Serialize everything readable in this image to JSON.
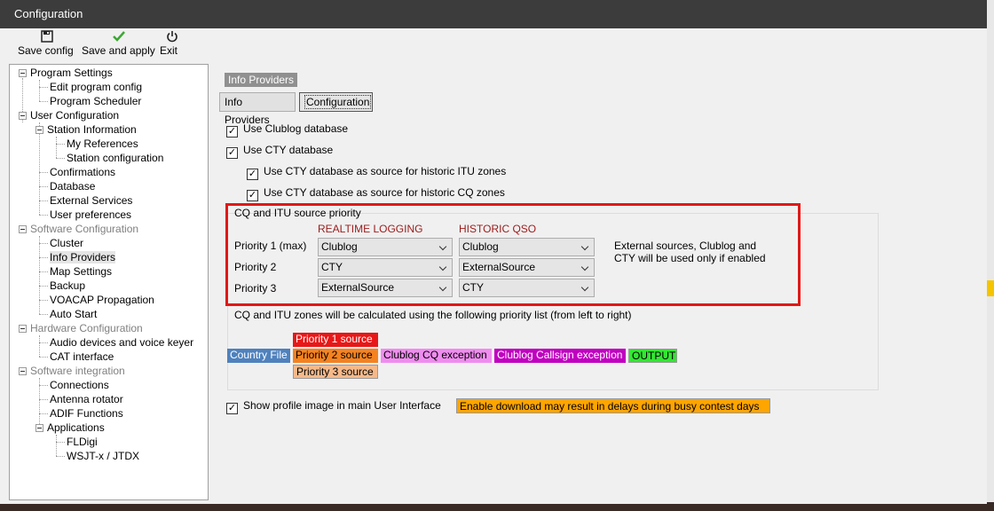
{
  "window": {
    "title": "Configuration"
  },
  "toolbar": {
    "save_config": "Save config",
    "save_apply": "Save and apply",
    "exit": "Exit"
  },
  "tree": {
    "program_settings": "Program Settings",
    "edit_program_config": "Edit program config",
    "program_scheduler": "Program Scheduler",
    "user_configuration": "User Configuration",
    "station_information": "Station Information",
    "my_references": "My References",
    "station_configuration": "Station configuration",
    "confirmations": "Confirmations",
    "database": "Database",
    "external_services": "External Services",
    "user_preferences": "User preferences",
    "software_configuration": "Software Configuration",
    "cluster": "Cluster",
    "info_providers": "Info Providers",
    "map_settings": "Map Settings",
    "backup": "Backup",
    "voacap": "VOACAP Propagation",
    "auto_start": "Auto Start",
    "hardware_configuration": "Hardware Configuration",
    "audio_devices": "Audio devices and voice keyer",
    "cat_interface": "CAT interface",
    "software_integration": "Software integration",
    "connections": "Connections",
    "antenna_rotator": "Antenna rotator",
    "adif_functions": "ADIF Functions",
    "applications": "Applications",
    "fldigi": "FLDigi",
    "wsjt": "WSJT-x / JTDX"
  },
  "page": {
    "group_title": "Info Providers",
    "tabs": [
      "Info Providers",
      "Configuration"
    ],
    "active_tab": "Configuration"
  },
  "options": {
    "use_clublog": "Use Clublog database",
    "use_cty": "Use CTY database",
    "cty_itu": "Use CTY database as source for historic ITU zones",
    "cty_cq": "Use CTY database as source for historic CQ zones",
    "show_profile": "Show profile image in main User Interface",
    "profile_warning": "Enable download may result in delays during busy contest days",
    "checked": "✓"
  },
  "priority": {
    "title": "CQ and ITU source priority",
    "realtime_header": "REALTIME LOGGING",
    "historic_header": "HISTORIC QSO",
    "row_labels": [
      "Priority 1 (max)",
      "Priority 2",
      "Priority 3"
    ],
    "realtime": [
      "Clublog",
      "CTY",
      "ExternalSource"
    ],
    "historic": [
      "Clublog",
      "ExternalSource",
      "CTY"
    ],
    "note_line1": "External sources, Clublog and",
    "note_line2": "CTY will be used only if enabled",
    "explanation": "CQ and ITU zones will be calculated using the following priority list (from left to right)"
  },
  "flow": {
    "country_file": "Country File",
    "priority1": "Priority 1 source",
    "priority2": "Priority 2 source",
    "priority3": "Priority 3 source",
    "clublog_cq": "Clublog CQ exception",
    "clublog_call": "Clublog Callsign exception",
    "output": "OUTPUT"
  },
  "colors": {
    "country_file": "#4f81bd",
    "priority1": "#e81818",
    "priority2": "#f58220",
    "priority3": "#f5b98a",
    "clublog_cq": "#f08cf0",
    "clublog_call": "#c000c0",
    "output": "#33e633",
    "warning": "#ffa500",
    "highlight": "#e01818"
  }
}
